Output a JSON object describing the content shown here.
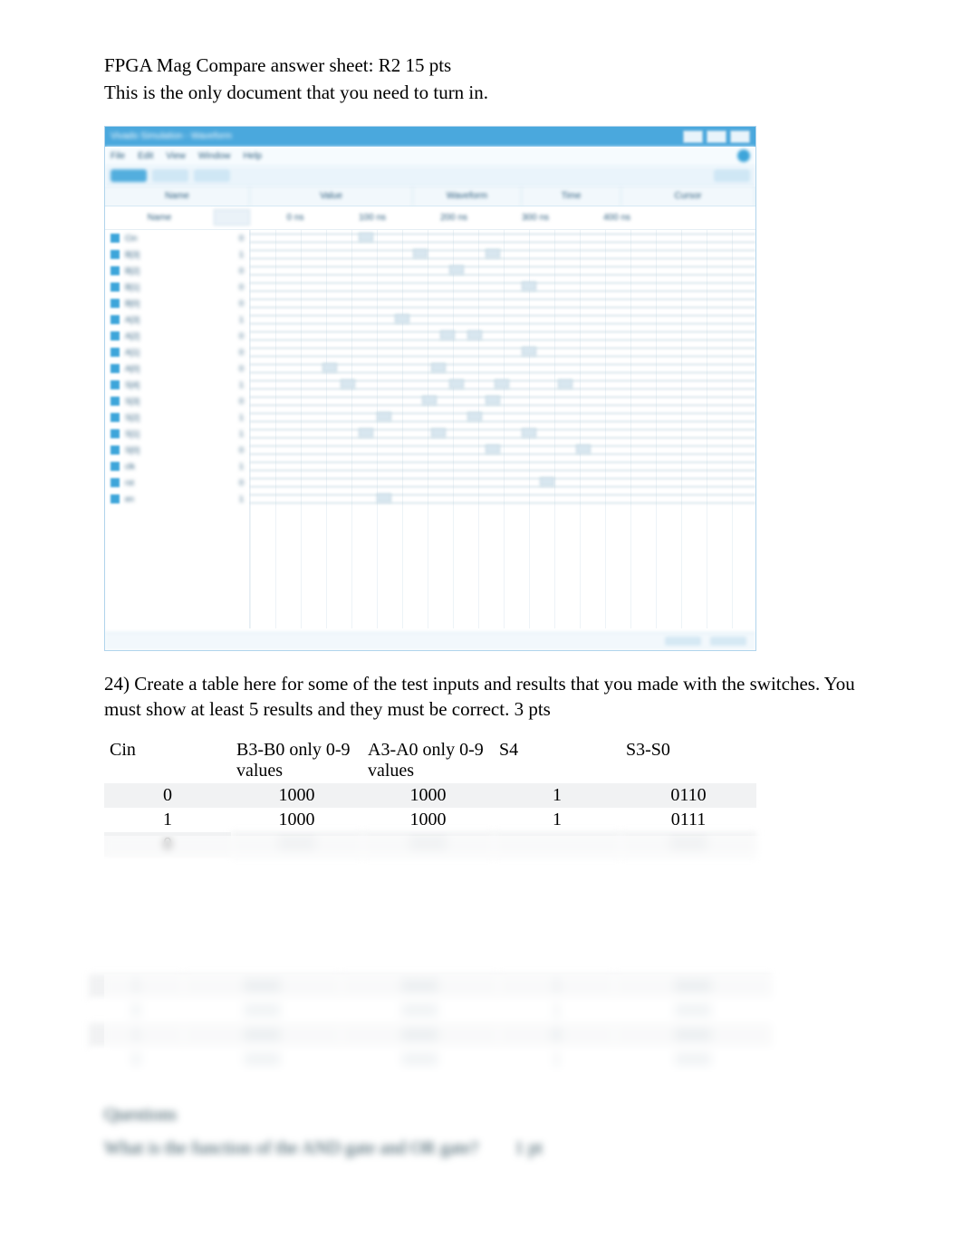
{
  "header": {
    "line1": "FPGA Mag Compare answer sheet:  R2   15 pts",
    "line2": "This is the only document that you need to turn in."
  },
  "embedded_app": {
    "title": "Vivado Simulation - Waveform",
    "menus": [
      "File",
      "Edit",
      "View",
      "Window",
      "Help"
    ],
    "ribbon_tabs": [
      "Run",
      "Zoom",
      "Cursor"
    ],
    "panel_headers": [
      "Name",
      "Value",
      "Waveform",
      "Time",
      "Cursor"
    ],
    "sub_headers": [
      "Name",
      "",
      "",
      "0 ns",
      "100 ns",
      "200 ns",
      "300 ns",
      "400 ns"
    ],
    "signals": [
      {
        "name": "Cin",
        "value": "0"
      },
      {
        "name": "B[3]",
        "value": "1"
      },
      {
        "name": "B[2]",
        "value": "0"
      },
      {
        "name": "B[1]",
        "value": "0"
      },
      {
        "name": "B[0]",
        "value": "0"
      },
      {
        "name": "A[3]",
        "value": "1"
      },
      {
        "name": "A[2]",
        "value": "0"
      },
      {
        "name": "A[1]",
        "value": "0"
      },
      {
        "name": "A[0]",
        "value": "0"
      },
      {
        "name": "S[4]",
        "value": "1"
      },
      {
        "name": "S[3]",
        "value": "0"
      },
      {
        "name": "S[2]",
        "value": "1"
      },
      {
        "name": "S[1]",
        "value": "1"
      },
      {
        "name": "S[0]",
        "value": "0"
      },
      {
        "name": "clk",
        "value": "1"
      },
      {
        "name": "rst",
        "value": "0"
      },
      {
        "name": "en",
        "value": "1"
      }
    ],
    "status": [
      "Sim",
      "100%"
    ]
  },
  "question24": {
    "text_a": "24)  Create a table here for some of the test inputs and results that you made with the switches.        You",
    "text_b": "must show at least 5 results and they must be correct.      3 pts"
  },
  "table": {
    "headers": {
      "c1": "Cin",
      "c2": "B3-B0 only 0-9 values",
      "c3": "A3-A0 only 0-9 values",
      "c4": "S4",
      "c5": "S3-S0"
    },
    "rows": [
      {
        "cin": "0",
        "b": "1000",
        "a": "1000",
        "s4": "1",
        "s": "0110"
      },
      {
        "cin": "1",
        "b": "1000",
        "a": "1000",
        "s4": "1",
        "s": "0111"
      },
      {
        "cin": "0",
        "b": "",
        "a": "",
        "s4": "",
        "s": ""
      }
    ]
  },
  "lower_table": {
    "rows": [
      {
        "c1": "1",
        "c2": "",
        "c3": "",
        "c4": "",
        "c5": "1",
        "c6": ""
      },
      {
        "c1": "0",
        "c2": "",
        "c3": "",
        "c4": "",
        "c5": "1",
        "c6": ""
      },
      {
        "c1": "1",
        "c2": "",
        "c3": "",
        "c4": "",
        "c5": "0",
        "c6": ""
      },
      {
        "c1": "0",
        "c2": "",
        "c3": "",
        "c4": "",
        "c5": "1",
        "c6": ""
      }
    ]
  },
  "questions_section": {
    "heading": "Questions",
    "q1_text": "What is the function of the AND gate and OR gate?",
    "q1_pts": "1 pt"
  }
}
